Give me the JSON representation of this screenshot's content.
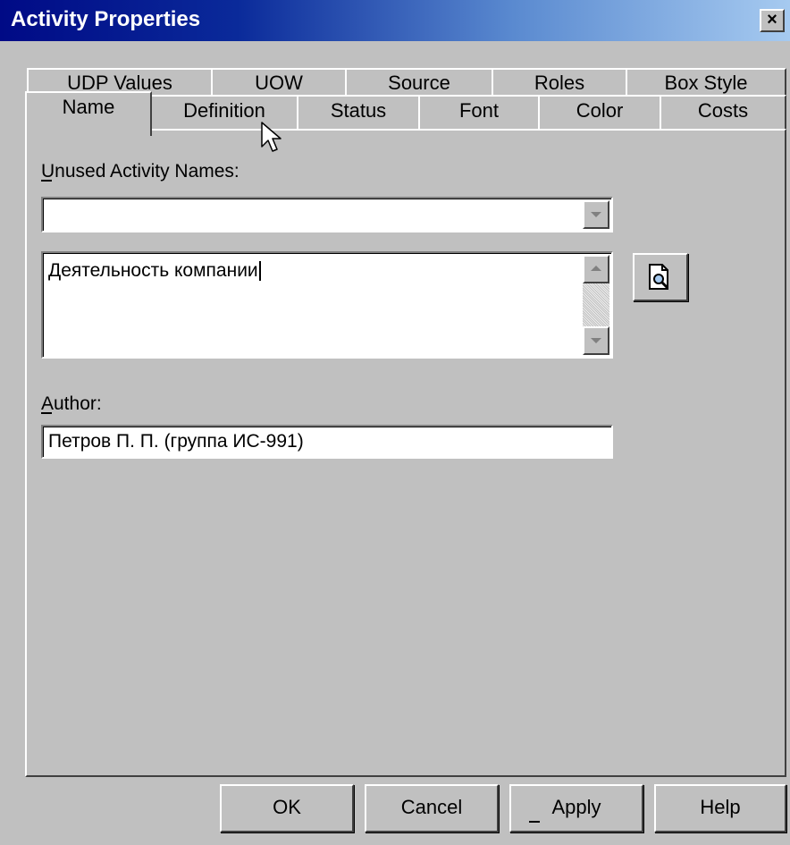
{
  "window": {
    "title": "Activity Properties",
    "close_glyph": "×"
  },
  "tabs": {
    "row1": [
      "UDP Values",
      "UOW",
      "Source",
      "Roles",
      "Box Style"
    ],
    "row2": [
      "Name",
      "Definition",
      "Status",
      "Font",
      "Color",
      "Costs"
    ],
    "active": "Name"
  },
  "form": {
    "unused_names_label": "Unused Activity Names:",
    "unused_names_value": "",
    "name_value": "Деятельность компании",
    "author_label": "Author:",
    "author_value": "Петров П. П. (группа ИС-991)"
  },
  "buttons": {
    "ok": "OK",
    "cancel": "Cancel",
    "apply": "Apply",
    "help": "Help"
  },
  "icons": {
    "browse": "document-magnifier-icon",
    "cursor": "mouse-pointer-icon"
  },
  "colors": {
    "title_gradient_start": "#000a86",
    "title_gradient_end": "#a6caf0",
    "dialog_face": "#c0c0c0"
  }
}
